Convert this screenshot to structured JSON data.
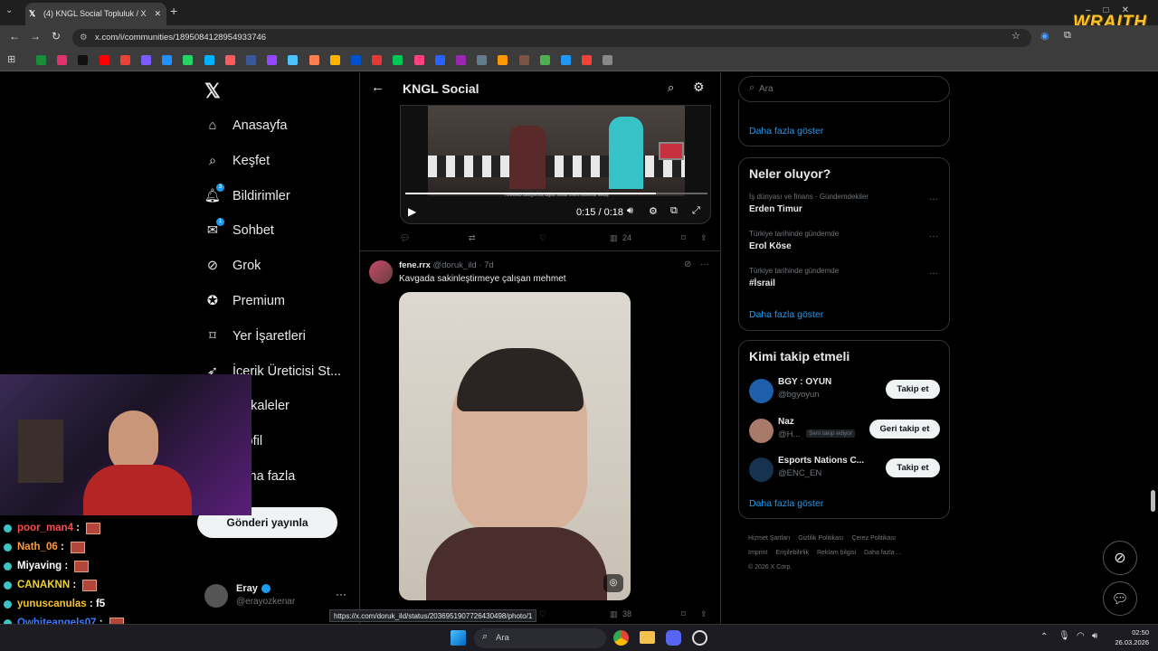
{
  "browser": {
    "tab_title": "(4) KNGL Social Topluluk / X",
    "url": "x.com/i/communities/1895084128954933746",
    "status_url": "https://x.com/doruk_ild/status/2036951907726430498/photo/1",
    "overlay_brand": "WRAITH"
  },
  "nav": {
    "items": [
      {
        "label": "Anasayfa",
        "icon": "home-icon"
      },
      {
        "label": "Keşfet",
        "icon": "search-icon"
      },
      {
        "label": "Bildirimler",
        "icon": "bell-icon",
        "badge": "3"
      },
      {
        "label": "Sohbet",
        "icon": "mail-icon",
        "badge": "1"
      },
      {
        "label": "Grok",
        "icon": "grok-icon"
      },
      {
        "label": "Premium",
        "icon": "premium-icon"
      },
      {
        "label": "Yer İşaretleri",
        "icon": "bookmark-icon"
      },
      {
        "label": "İçerik Üreticisi St...",
        "icon": "rocket-icon"
      },
      {
        "label": "Makaleler",
        "icon": "article-icon"
      },
      {
        "label": "Profil",
        "icon": "person-icon"
      },
      {
        "label": "Daha fazla",
        "icon": "more-icon"
      }
    ],
    "post_button": "Gönderi yayınla",
    "user": {
      "name": "Eray",
      "handle": "@erayozkenar"
    }
  },
  "feed": {
    "title": "KNGL Social",
    "video": {
      "time": "0:15 / 0:18",
      "progress": 0.83,
      "subtitle": "Yönetimsiz kaldığımızda sağlıklı dostlar kontrol edilmelidir mesajı"
    },
    "post1_actions": {
      "views": "24"
    },
    "post2": {
      "name": "fene.rrx",
      "handle": "@doruk_ild",
      "time": "· 7d",
      "text": "Kavgada sakinleştirmeye çalışan mehmet",
      "views": "38"
    }
  },
  "right": {
    "search_placeholder": "Ara",
    "top_more": "Daha fazla göster",
    "trends_title": "Neler oluyor?",
    "trends": [
      {
        "meta": "İş dünyası ve finans · Gündemdekiler",
        "name": "Erden Timur"
      },
      {
        "meta": "Türkiye tarihinde gündemde",
        "name": "Erol Köse"
      },
      {
        "meta": "Türkiye tarihinde gündemde",
        "name": "#İsrail"
      }
    ],
    "trends_more": "Daha fazla göster",
    "follow_title": "Kimi takip etmeli",
    "follow": [
      {
        "name": "BGY : OYUN",
        "handle": "@bgyoyun",
        "button": "Takip et",
        "color": "#1d5fa8"
      },
      {
        "name": "Naz",
        "handle": "@H...",
        "tag": "Seni takip ediyor",
        "button": "Geri takip et",
        "color": "#a77a6a"
      },
      {
        "name": "Esports Nations C...",
        "handle": "@ENC_EN",
        "button": "Takip et",
        "color": "#17324f"
      }
    ],
    "follow_more": "Daha fazla göster",
    "footer": [
      "Hizmet Şartları",
      "Gizlilik Politikası",
      "Çerez Politikası",
      "Imprint",
      "Erişilebilirlik",
      "Reklam bilgisi",
      "Daha fazla ...",
      "© 2026 X Corp."
    ]
  },
  "chat": [
    {
      "user": "poor_man4",
      "color": "#ff4a4a",
      "msg": ""
    },
    {
      "user": "Nath_06",
      "color": "#ff9a3c",
      "msg": ""
    },
    {
      "user": "Miyaving",
      "color": "#ffffff",
      "msg": ""
    },
    {
      "user": "CANAKNN",
      "color": "#f2d22e",
      "msg": ""
    },
    {
      "user": "yunuscanulas",
      "color": "#f7c326",
      "msg": "f5"
    },
    {
      "user": "Owhiteangels07",
      "color": "#3a7bff",
      "msg": ""
    },
    {
      "user": "Buse_z",
      "color": "#c27aff",
      "msg": ""
    }
  ],
  "taskbar": {
    "search": "Ara",
    "time": "02:50",
    "date": "26.03.2026"
  }
}
